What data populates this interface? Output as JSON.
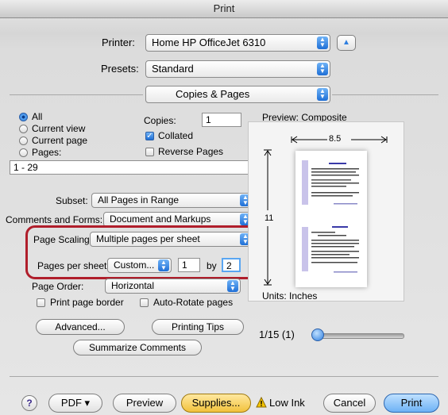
{
  "window": {
    "title": "Print"
  },
  "printer": {
    "label": "Printer:",
    "value": "Home HP OfficeJet 6310"
  },
  "presets": {
    "label": "Presets:",
    "value": "Standard"
  },
  "section": {
    "value": "Copies & Pages"
  },
  "pages": {
    "all": "All",
    "current_view": "Current view",
    "current_page": "Current page",
    "pages": "Pages:",
    "range": "1 - 29"
  },
  "copies": {
    "label": "Copies:",
    "value": "1",
    "collated": "Collated",
    "reverse": "Reverse Pages"
  },
  "subset": {
    "label": "Subset:",
    "value": "All Pages in Range"
  },
  "comments": {
    "label": "Comments and Forms:",
    "value": "Document and Markups"
  },
  "scaling": {
    "label": "Page Scaling:",
    "value": "Multiple pages per sheet"
  },
  "pps": {
    "label": "Pages per sheet:",
    "value": "Custom...",
    "cols": "1",
    "by": "by",
    "rows": "2"
  },
  "order": {
    "label": "Page Order:",
    "value": "Horizontal"
  },
  "options": {
    "border": "Print page border",
    "autorotate": "Auto-Rotate pages"
  },
  "buttons": {
    "advanced": "Advanced...",
    "tips": "Printing Tips",
    "summarize": "Summarize Comments",
    "pdf": "PDF ▾",
    "preview": "Preview",
    "supplies": "Supplies...",
    "lowink": "Low Ink",
    "cancel": "Cancel",
    "print": "Print"
  },
  "preview": {
    "title": "Preview: Composite",
    "width": "8.5",
    "height": "11",
    "units": "Units: Inches",
    "page_counter": "1/15 (1)"
  },
  "colors": {
    "accent": "#2f7fe0",
    "highlight": "#b01e2b",
    "supplies": "#f2c23c"
  },
  "icons": {
    "help": "help-icon",
    "warning": "warning-icon",
    "collapse": "disclosure-up-icon"
  },
  "slider": {
    "position_fraction": 0.0
  }
}
